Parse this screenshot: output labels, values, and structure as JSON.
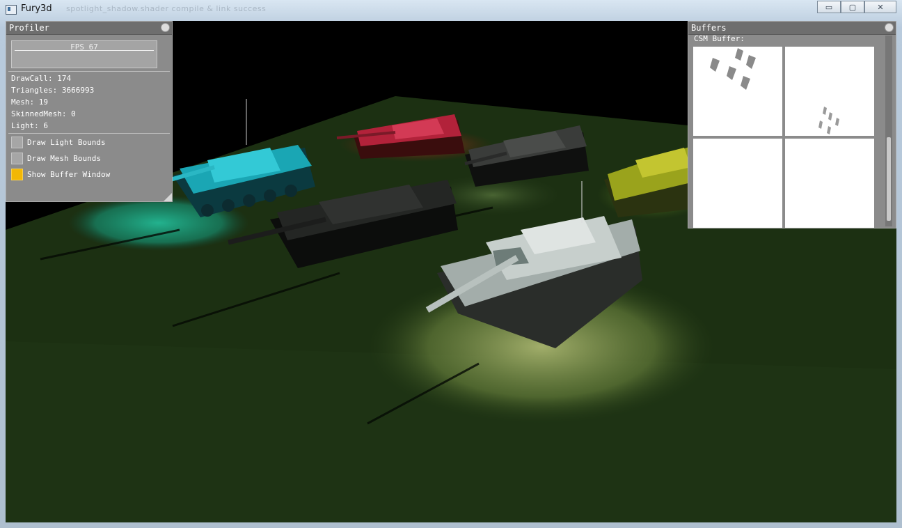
{
  "window": {
    "title": "Fury3d",
    "background_caption": "spotlight_shadow.shader compile & link success",
    "minimize_glyph": "▭",
    "maximize_glyph": "▢",
    "close_glyph": "✕"
  },
  "profiler": {
    "title": "Profiler",
    "fps_label": "FPS 67",
    "stats": {
      "drawcall": "DrawCall: 174",
      "triangles": "Triangles: 3666993",
      "mesh": "Mesh: 19",
      "skinned_mesh": "SkinnedMesh: 0",
      "light": "Light: 6"
    },
    "options": [
      {
        "label": "Draw Light Bounds",
        "checked": false
      },
      {
        "label": "Draw Mesh Bounds",
        "checked": false
      },
      {
        "label": "Show Buffer Window",
        "checked": true
      }
    ]
  },
  "buffers": {
    "title": "Buffers",
    "csm_label": "CSM Buffer:"
  },
  "colors": {
    "panel_bg": "#8b8b8b",
    "checkbox_on": "#f2b705",
    "ground": "#1c3012",
    "spot_cyan": "#1fae8c",
    "spot_red": "#b3391a",
    "spot_yellow": "#7a9a2b",
    "spot_white": "#8ea05a"
  }
}
